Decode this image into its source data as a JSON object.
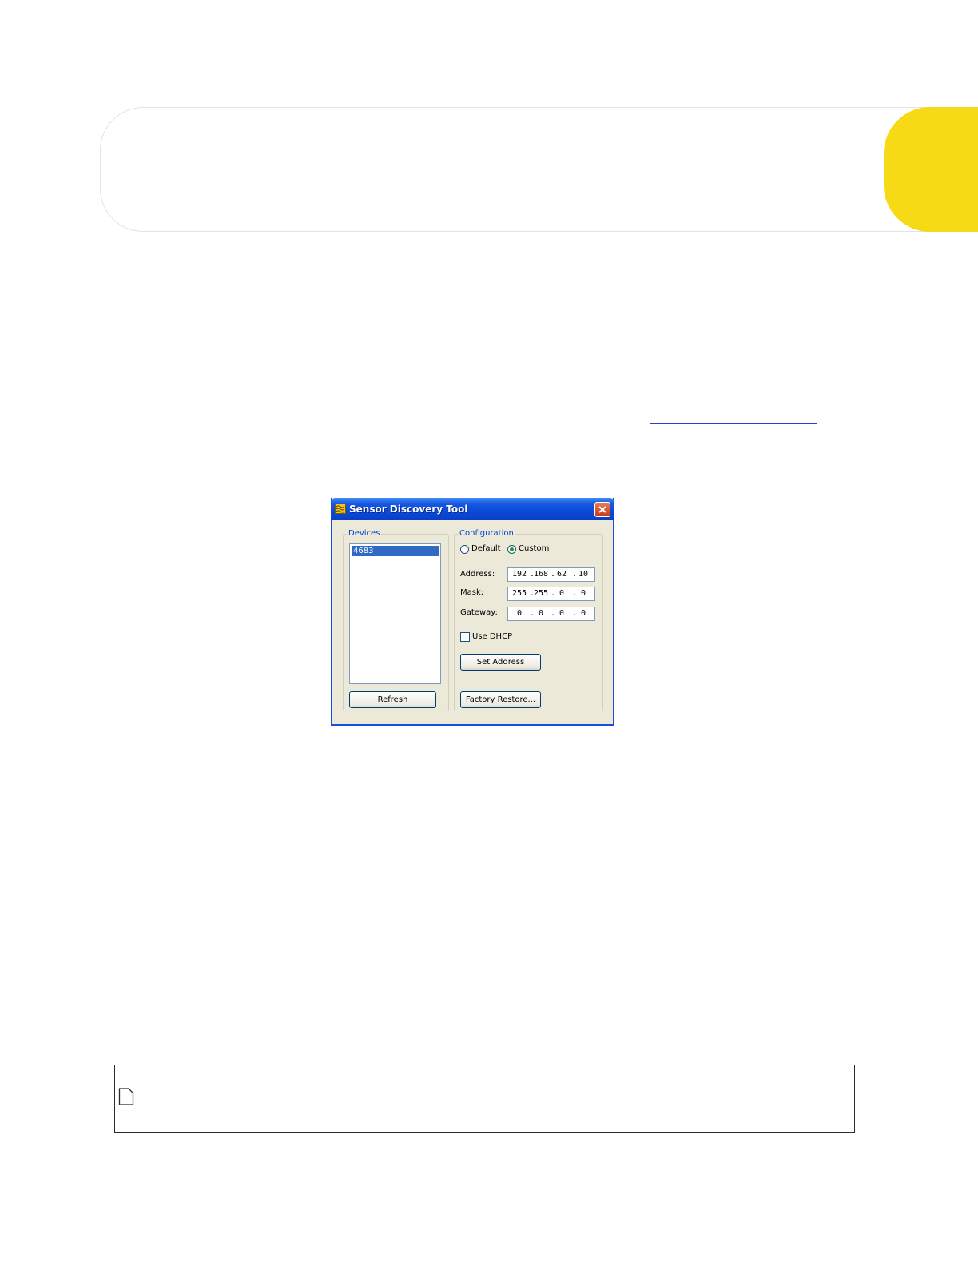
{
  "dialog": {
    "title": "Sensor Discovery Tool",
    "devices_group": "Devices",
    "devices": [
      "4683"
    ],
    "refresh_button": "Refresh",
    "configuration_group": "Configuration",
    "mode_options": [
      "Default",
      "Custom"
    ],
    "selected_mode": "Custom",
    "address_label": "Address:",
    "address": [
      "192",
      "168",
      "62",
      "10"
    ],
    "mask_label": "Mask:",
    "mask": [
      "255",
      "255",
      "0",
      "0"
    ],
    "gateway_label": "Gateway:",
    "gateway": [
      "0",
      "0",
      "0",
      "0"
    ],
    "use_dhcp_label": "Use DHCP",
    "use_dhcp_checked": false,
    "set_address_button": "Set Address",
    "factory_restore_button": "Factory Restore..."
  },
  "colors": {
    "accent_yellow": "#f7da16",
    "xp_title_blue": "#0a4ad8",
    "selection_blue": "#316ac5"
  }
}
